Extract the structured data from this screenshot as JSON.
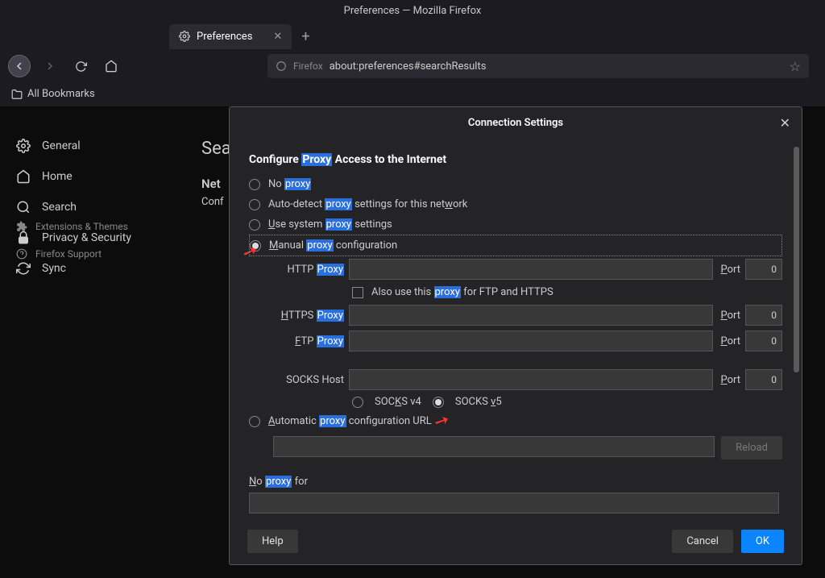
{
  "window_title": "Preferences — Mozilla Firefox",
  "tab": {
    "label": "Preferences"
  },
  "url": {
    "prefix": "Firefox",
    "value": "about:preferences#searchResults"
  },
  "bookmarks_label": "All Bookmarks",
  "sidebar": {
    "items": [
      {
        "label": "General"
      },
      {
        "label": "Home"
      },
      {
        "label": "Search"
      },
      {
        "label": "Privacy & Security"
      },
      {
        "label": "Sync"
      }
    ],
    "bottom": [
      {
        "label": "Extensions & Themes"
      },
      {
        "label": "Firefox Support"
      }
    ]
  },
  "bg": {
    "h1": "Sea",
    "h2": "Net",
    "p": "Conf"
  },
  "modal": {
    "title": "Connection Settings",
    "heading_pre": "Configure ",
    "heading_hl": "Proxy",
    "heading_post": " Access to the Internet",
    "opts": {
      "no_proxy_pre": "No ",
      "no_proxy_hl": "proxy",
      "auto_pre": "Auto-detect ",
      "auto_hl": "proxy",
      "auto_post": " settings for this net",
      "auto_u": "w",
      "auto_post2": "ork",
      "use_u": "U",
      "use_pre": "se system ",
      "use_hl": "proxy",
      "use_post": " settings",
      "man_u": "M",
      "man_pre": "anual ",
      "man_hl": "proxy",
      "man_post": " configuration",
      "autoconf_u": "A",
      "autoconf_pre": "utomatic ",
      "autoconf_hl": "proxy",
      "autoconf_post": " configuration URL"
    },
    "http": {
      "label_pre": "HTTP ",
      "label_hl": "Proxy",
      "port": "0"
    },
    "also_pre": "Also use this ",
    "also_hl": "proxy",
    "also_post": " for FTP and HTTPS",
    "https": {
      "u": "H",
      "label_pre": "TTPS ",
      "label_hl": "Proxy",
      "port": "0"
    },
    "ftp": {
      "u": "F",
      "label_pre": "TP ",
      "label_hl": "Proxy",
      "port": "0"
    },
    "socks": {
      "label": "SOCKS Host",
      "port": "0",
      "v4_pre": "SOC",
      "v4_u": "K",
      "v4_post": "S v4",
      "v5_pre": "SOCKS ",
      "v5_u": "v",
      "v5_post": "5"
    },
    "port_label": "P",
    "port_label2": "ort",
    "reload": "Reload",
    "noproxy_pre": "N",
    "noproxy_u": "o",
    "noproxy_post": " ",
    "noproxy_hl": "proxy",
    "noproxy_post2": " for",
    "buttons": {
      "help": "Help",
      "cancel": "Cancel",
      "ok": "OK"
    }
  }
}
